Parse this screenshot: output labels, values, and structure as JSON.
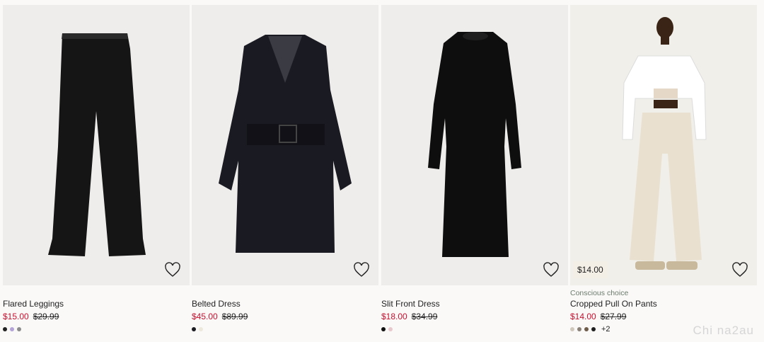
{
  "products": [
    {
      "tag": "",
      "name": "Flared Leggings",
      "sale_price": "$15.00",
      "original_price": "$29.99",
      "swatches": [
        "#222222",
        "#b3a3d6",
        "#8c8c8c"
      ],
      "more_colors": "",
      "badge": ""
    },
    {
      "tag": "",
      "name": "Belted Dress",
      "sale_price": "$45.00",
      "original_price": "$89.99",
      "swatches": [
        "#1b1b22",
        "#ece8dc"
      ],
      "more_colors": "",
      "badge": ""
    },
    {
      "tag": "",
      "name": "Slit Front Dress",
      "sale_price": "$18.00",
      "original_price": "$34.99",
      "swatches": [
        "#111111",
        "#e7c8cc"
      ],
      "more_colors": "",
      "badge": ""
    },
    {
      "tag": "Conscious choice",
      "name": "Cropped Pull On Pants",
      "sale_price": "$14.00",
      "original_price": "$27.99",
      "swatches": [
        "#cfc8bc",
        "#8a8178",
        "#6e5c4a",
        "#1e1e1e"
      ],
      "more_colors": "+2",
      "badge": "$14.00"
    }
  ],
  "watermark": "Chi na2au",
  "icons": {
    "favorite": "heart-outline-icon"
  },
  "colors": {
    "sale": "#c8102e",
    "image_bg": "#eeedeb",
    "page_bg": "#faf9f8"
  }
}
